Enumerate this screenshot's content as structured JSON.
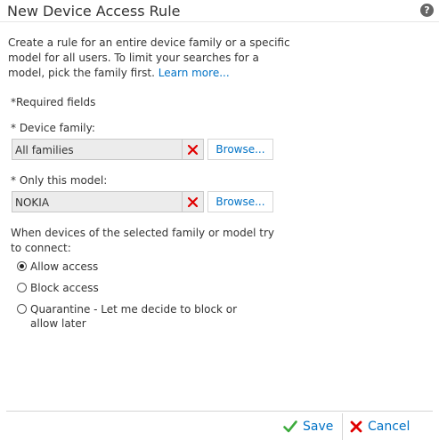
{
  "dialog": {
    "title": "New Device Access Rule",
    "help_glyph": "?",
    "description": "Create a rule for an entire device family or a specific model for all users. To limit your searches for a model, pick the family first.",
    "learn_more": "Learn more...",
    "required_note": "*Required fields"
  },
  "device_family": {
    "label": "* Device family:",
    "value": "All families",
    "browse_label": "Browse..."
  },
  "model": {
    "label": "* Only this model:",
    "value": "NOKIA",
    "browse_label": "Browse..."
  },
  "connect": {
    "prompt": "When devices of the selected family or model try to connect:",
    "options": [
      {
        "label": "Allow access",
        "selected": true
      },
      {
        "label": "Block access",
        "selected": false
      },
      {
        "label": "Quarantine - Let me decide to block or allow later",
        "selected": false
      }
    ]
  },
  "footer": {
    "save_label": "Save",
    "cancel_label": "Cancel"
  },
  "colors": {
    "link": "#0072c6",
    "clear_x": "#e00000",
    "save_check": "#3cab3c"
  }
}
